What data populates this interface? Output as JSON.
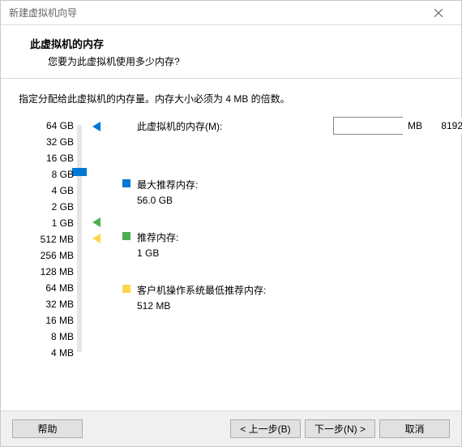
{
  "window": {
    "title": "新建虚拟机向导"
  },
  "header": {
    "heading": "此虚拟机的内存",
    "sub": "您要为此虚拟机使用多少内存?"
  },
  "instruction": "指定分配给此虚拟机的内存量。内存大小必须为 4 MB 的倍数。",
  "ticks": [
    "64 GB",
    "32 GB",
    "16 GB",
    "8 GB",
    "4 GB",
    "2 GB",
    "1 GB",
    "512 MB",
    "256 MB",
    "128 MB",
    "64 MB",
    "32 MB",
    "16 MB",
    "8 MB",
    "4 MB"
  ],
  "main_label": "此虚拟机的内存(M):",
  "input_value": "8192",
  "unit": "MB",
  "blocks": {
    "max": {
      "label": "最大推荐内存:",
      "value": "56.0 GB"
    },
    "rec": {
      "label": "推荐内存:",
      "value": "1 GB"
    },
    "min": {
      "label": "客户机操作系统最低推荐内存:",
      "value": "512 MB"
    }
  },
  "buttons": {
    "help": "帮助",
    "back": "< 上一步(B)",
    "next": "下一步(N) >",
    "cancel": "取消"
  }
}
